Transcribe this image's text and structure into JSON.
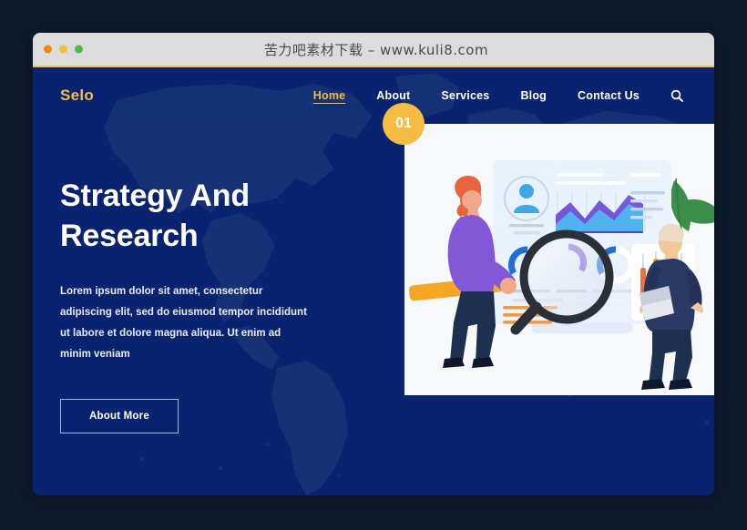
{
  "window": {
    "title": "苦力吧素材下载 – www.kuli8.com",
    "traffic_lights": [
      "close",
      "minimize",
      "maximize"
    ]
  },
  "nav": {
    "logo": "Selo",
    "items": [
      {
        "label": "Home",
        "active": true
      },
      {
        "label": "About",
        "active": false
      },
      {
        "label": "Services",
        "active": false
      },
      {
        "label": "Blog",
        "active": false
      },
      {
        "label": "Contact Us",
        "active": false
      }
    ],
    "search_icon": "search-icon"
  },
  "hero": {
    "badge": "01",
    "title": "Strategy And Research",
    "description": "Lorem ipsum dolor sit amet, consectetur adipiscing elit, sed do eiusmod tempor incididunt ut labore et dolore magna aliqua. Ut enim ad minim veniam",
    "cta_label": "About More"
  },
  "colors": {
    "page_background": "#0d1b2e",
    "hero_background": "#0a2370",
    "map_shape": "#1e3a7a",
    "accent_yellow": "#f5bc42",
    "titlebar": "#dcdcdc",
    "card_background": "#f7f8fa",
    "text_white": "#ffffff"
  },
  "illustration": {
    "name": "data-research-illustration",
    "elements": [
      "dashboard-card",
      "avatar-circle",
      "area-chart",
      "text-lines",
      "donut-charts",
      "magnifying-glass",
      "woman-figure",
      "man-figure",
      "candlestick-panel",
      "leaf-plant"
    ]
  }
}
